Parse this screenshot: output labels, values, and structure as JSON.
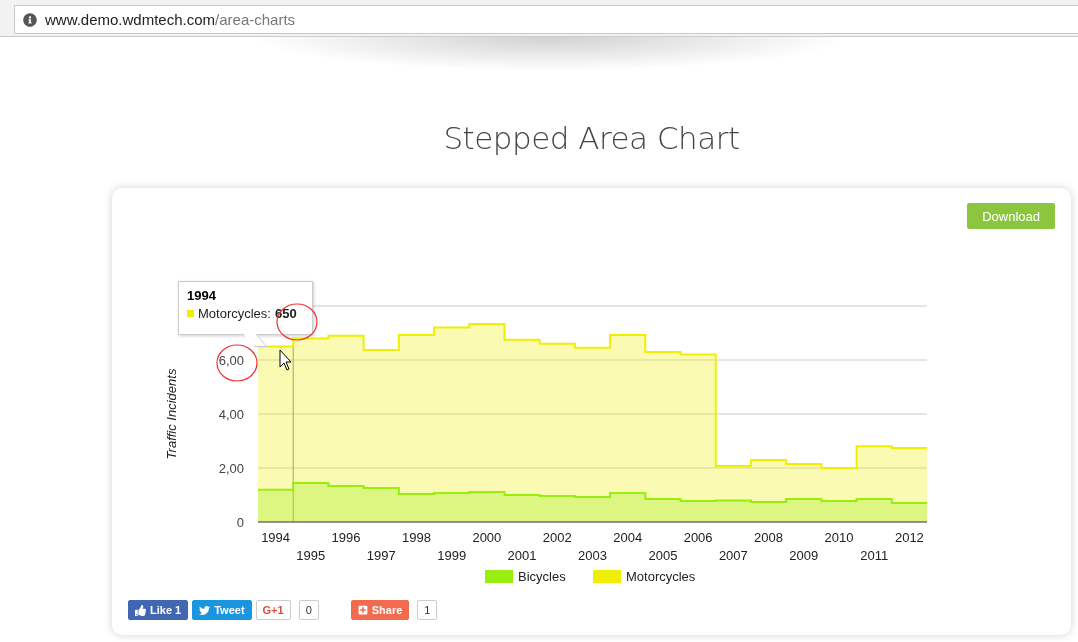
{
  "browser": {
    "url_host": "www.demo.wdmtech.com",
    "url_path": "/area-charts"
  },
  "title": "Stepped Area Chart",
  "download_button": "Download",
  "chart": {
    "chart_data": {
      "type": "area",
      "ylabel": "Traffic Incidents",
      "stacked": false,
      "grid": true,
      "legend": true,
      "x": [
        1993.5,
        1994.5,
        1994.5,
        1995.5,
        1995.5,
        1996.5,
        1996.5,
        1997.5,
        1997.5,
        1998.5,
        1998.5,
        1999.5,
        1999.5,
        2000.5,
        2000.5,
        2001.5,
        2001.5,
        2002.5,
        2002.5,
        2003.5,
        2003.5,
        2004.5,
        2004.5,
        2005.5,
        2005.5,
        2006.5,
        2006.5,
        2007.5,
        2007.5,
        2008.5,
        2008.5,
        2009.5,
        2009.5,
        2010.5,
        2010.5,
        2011.5,
        2011.5,
        2012.5
      ],
      "series": [
        {
          "name": "Bicycles",
          "color": "#99ee11",
          "values": [
            1.19,
            1.19,
            1.44,
            1.44,
            1.33,
            1.33,
            1.26,
            1.26,
            1.04,
            1.04,
            1.07,
            1.07,
            1.11,
            1.11,
            1.0,
            1.0,
            0.96,
            0.96,
            0.93,
            0.93,
            1.07,
            1.07,
            0.85,
            0.85,
            0.78,
            0.78,
            0.8,
            0.8,
            0.74,
            0.74,
            0.85,
            0.85,
            0.78,
            0.78,
            0.85,
            0.85,
            0.7,
            0.7
          ]
        },
        {
          "name": "Motorcycles",
          "color": "#eef000",
          "values": [
            6.5,
            6.5,
            6.8,
            6.8,
            6.9,
            6.9,
            6.37,
            6.37,
            6.93,
            6.93,
            7.2,
            7.2,
            7.33,
            7.33,
            6.75,
            6.75,
            6.6,
            6.6,
            6.45,
            6.45,
            6.93,
            6.93,
            6.3,
            6.3,
            6.2,
            6.2,
            2.07,
            2.07,
            2.3,
            2.3,
            2.15,
            2.15,
            2.0,
            2.0,
            2.81,
            2.81,
            2.74,
            2.74
          ]
        }
      ],
      "xlim": [
        1993.5,
        2012.5
      ],
      "ylim": [
        0,
        8
      ],
      "xticks": [
        1994,
        1996,
        1998,
        2000,
        2002,
        2004,
        2006,
        2008,
        2010,
        2012
      ],
      "yticks": [
        {
          "value": 0,
          "label": "0"
        },
        {
          "value": 2,
          "label": "2,00"
        },
        {
          "value": 4,
          "label": "4,00"
        },
        {
          "value": 6,
          "label": "6,00"
        }
      ],
      "ref_lines": [
        {
          "axis": "x",
          "value": 1994.5
        }
      ]
    },
    "x_labels_second_row": [
      "1995",
      "1997",
      "1999",
      "2001",
      "2003",
      "2005",
      "2007",
      "2009",
      "2011"
    ],
    "tooltip": {
      "title": "1994",
      "label": "Motorcycles:",
      "value": "650"
    }
  },
  "social": [
    {
      "kind": "facebook",
      "label": "Like 1"
    },
    {
      "kind": "twitter",
      "label": "Tweet"
    },
    {
      "kind": "gplus",
      "label": "G+1",
      "count": "0"
    },
    {
      "kind": "share",
      "label": "Share",
      "count": "1"
    }
  ]
}
